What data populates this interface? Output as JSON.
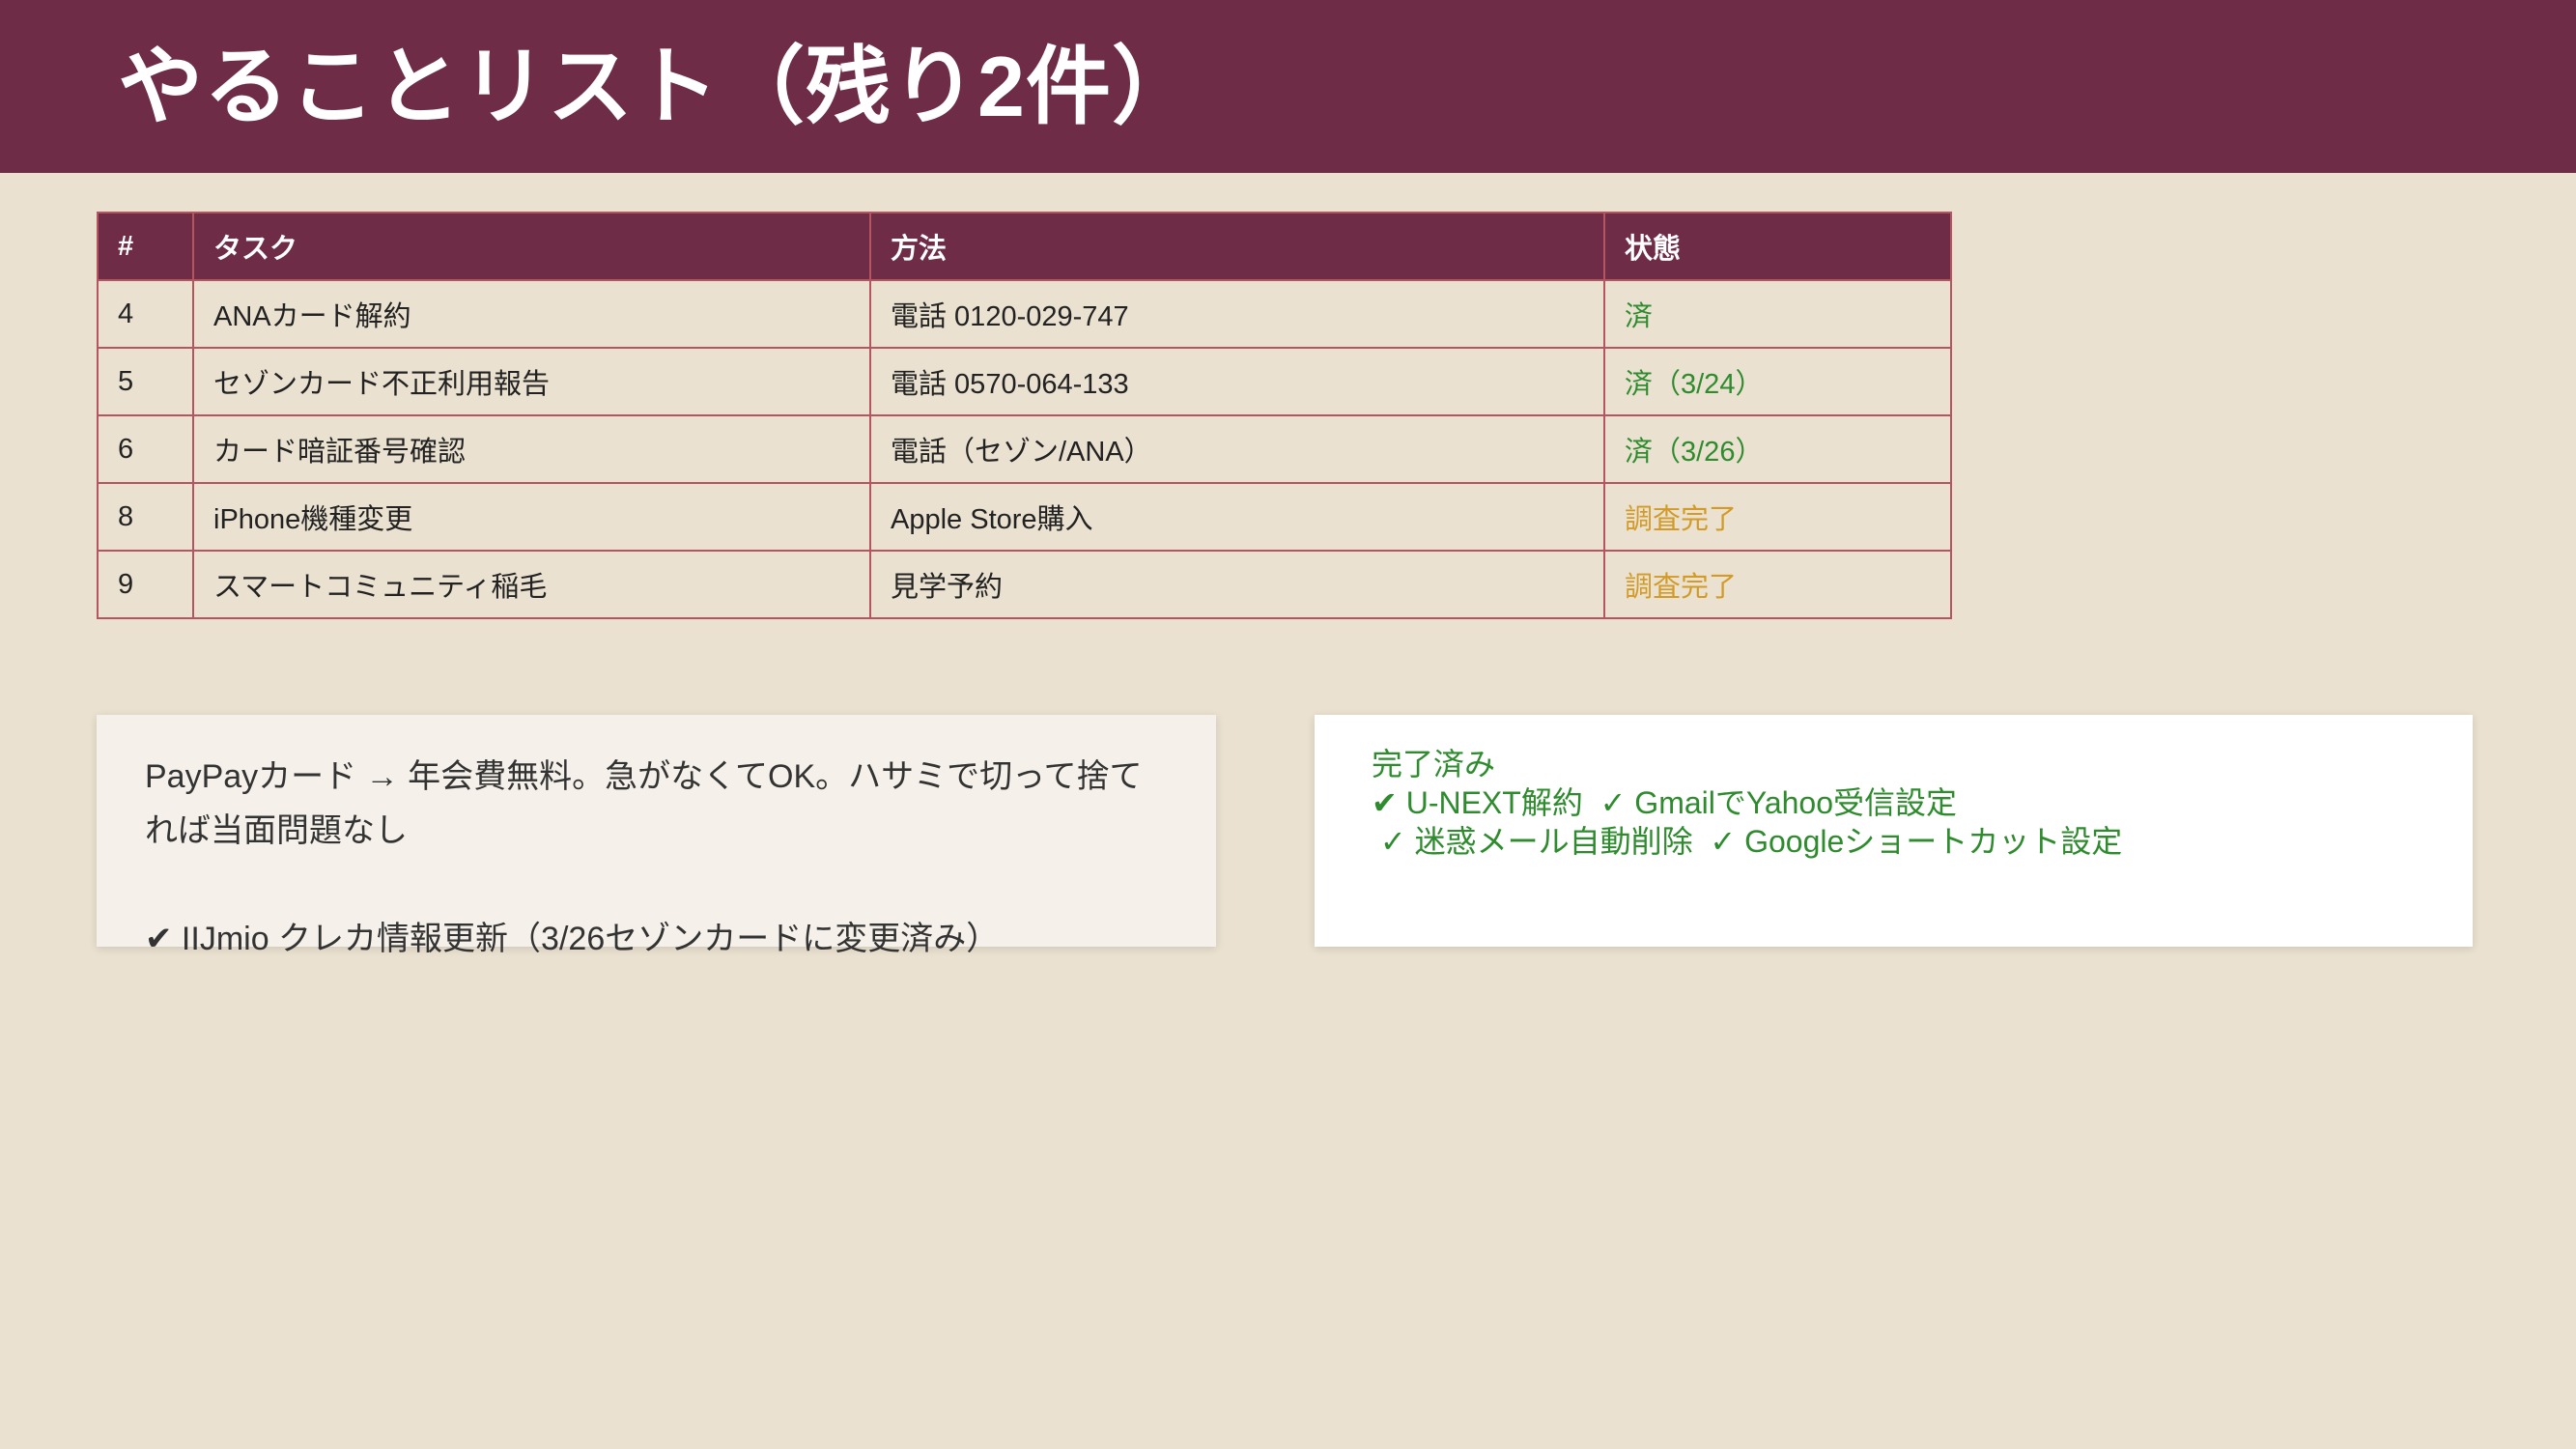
{
  "theme": {
    "header_bg": "#6E2C47",
    "page_bg": "#EAE1D0",
    "table_border": "#B4555F",
    "note_bg": "#F5F1EA",
    "done_card_bg": "#FFFFFF",
    "done_green": "#2E8B2E"
  },
  "header": {
    "title": "やることリスト（残り2件）"
  },
  "task_table": {
    "columns": {
      "number": "#",
      "task": "タスク",
      "method": "方法",
      "status": "状態"
    },
    "rows": [
      {
        "no": "4",
        "task": "ANAカード解約",
        "method": "電話 0120-029-747",
        "status": "済",
        "status_color": "#2E8B2E"
      },
      {
        "no": "5",
        "task": "セゾンカード不正利用報告",
        "method": "電話 0570-064-133",
        "status": "済（3/24）",
        "status_color": "#2E8B2E"
      },
      {
        "no": "6",
        "task": "カード暗証番号確認",
        "method": "電話（セゾン/ANA）",
        "status": "済（3/26）",
        "status_color": "#2E8B2E"
      },
      {
        "no": "8",
        "task": "iPhone機種変更",
        "method": "Apple Store購入",
        "status": "調査完了",
        "status_color": "#D29B28"
      },
      {
        "no": "9",
        "task": "スマートコミュニティ稲毛",
        "method": "見学予約",
        "status": "調査完了",
        "status_color": "#D29B28"
      }
    ]
  },
  "note_card": {
    "paragraph": "PayPayカード → 年会費無料。急がなくてOK。ハサミで切って捨てれば当面問題なし",
    "check_line": "✔ IIJmio クレカ情報更新（3/26セゾンカードに変更済み）"
  },
  "done_card": {
    "title": "完了済み",
    "lines": [
      "✔ U-NEXT解約  ✓ GmailでYahoo受信設定",
      " ✓ 迷惑メール自動削除  ✓ Googleショートカット設定"
    ]
  }
}
